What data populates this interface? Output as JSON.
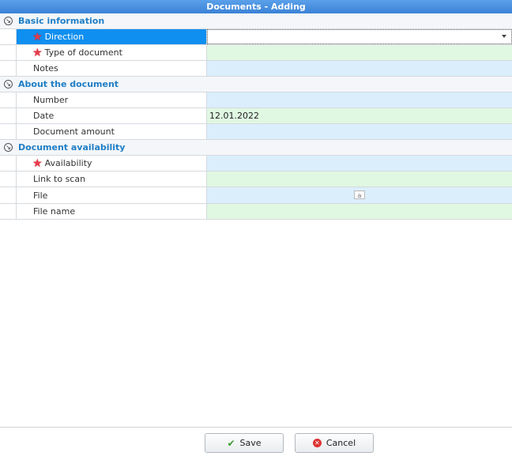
{
  "window": {
    "title": "Documents - Adding"
  },
  "sections": [
    {
      "title": "Basic information",
      "rows": [
        {
          "label": "Direction",
          "value": "",
          "required": true
        },
        {
          "label": "Type of document",
          "value": "",
          "required": true
        },
        {
          "label": "Notes",
          "value": ""
        }
      ]
    },
    {
      "title": "About the document",
      "rows": [
        {
          "label": "Number",
          "value": ""
        },
        {
          "label": "Date",
          "value": "12.01.2022"
        },
        {
          "label": "Document amount",
          "value": ""
        }
      ]
    },
    {
      "title": "Document availability",
      "rows": [
        {
          "label": "Availability",
          "value": "",
          "required": true
        },
        {
          "label": "Link to scan",
          "value": ""
        },
        {
          "label": "File",
          "value": "",
          "icon": "file-icon"
        },
        {
          "label": "File name",
          "value": ""
        }
      ]
    }
  ],
  "buttons": {
    "save": "Save",
    "cancel": "Cancel"
  },
  "colors": {
    "title_bar": "#3b82d6",
    "section_title": "#1f7ec6",
    "selected": "#0f8ff0",
    "cell_blue": "#dbeefc",
    "cell_green": "#e0f8e2",
    "required_star": "#e83b4b"
  }
}
